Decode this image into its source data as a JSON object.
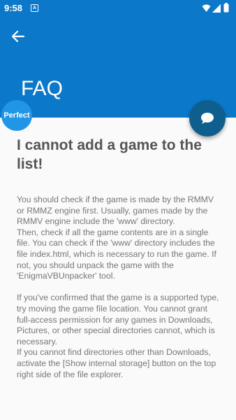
{
  "status_bar": {
    "time": "9:58",
    "notification_glyph": "A",
    "icons": [
      "wifi-icon",
      "signal-icon",
      "battery-icon"
    ]
  },
  "header": {
    "back_icon": "arrow-left-icon",
    "title": "FAQ",
    "color": "#0b78c9"
  },
  "fab": {
    "icon": "chat-bubble-icon",
    "color": "#0f5f8e"
  },
  "badge": {
    "label": "Perfect",
    "color": "#2196e6"
  },
  "faq": {
    "question": "I cannot add a game to the list!",
    "answer": "You should check if the game is made by the RMMV or RMMZ engine first. Usually, games made by the RMMV engine include the 'www' directory.\n Then, check if all the game contents are in a single file. You can check if the 'www' directory includes the file index.html, which is necessary to run the game. If not, you should unpack the game with the 'EnigmaVBUnpacker' tool.\n\n If you've confirmed that the game is a supported type, try moving the game file location. You cannot grant full-access permission for any games in Downloads, Pictures, or other special directories cannot, which is necessary.\n If you cannot find directories other than Downloads, activate the [Show internal storage] button on the top right side of the file explorer."
  }
}
